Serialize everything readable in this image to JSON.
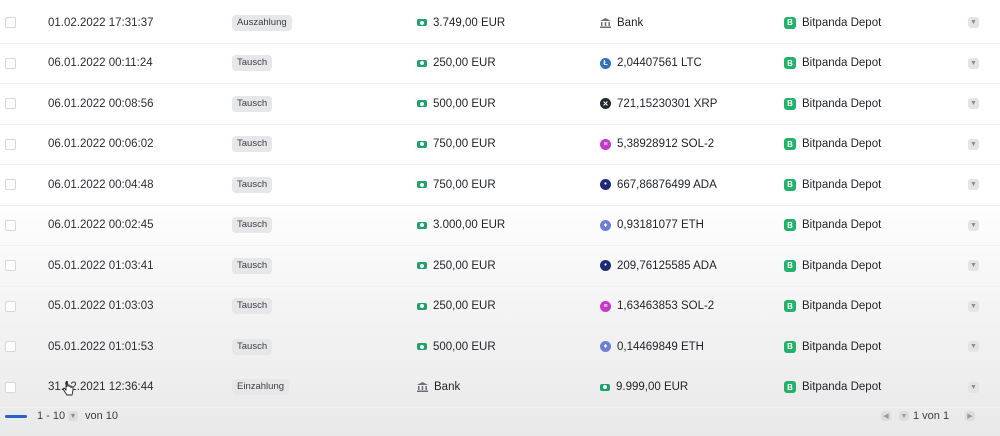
{
  "rows": [
    {
      "date": "01.02.2022 17:31:37",
      "type": "Auszahlung",
      "in_icon": "money-icon",
      "in": "3.749,00 EUR",
      "out_icon": "bank-icon",
      "out": "Bank",
      "wallet": "Bitpanda Depot"
    },
    {
      "date": "06.01.2022 00:11:24",
      "type": "Tausch",
      "in_icon": "money-icon",
      "in": "250,00 EUR",
      "out_icon": "litecoin-icon",
      "out": "2,04407561 LTC",
      "wallet": "Bitpanda Depot"
    },
    {
      "date": "06.01.2022 00:08:56",
      "type": "Tausch",
      "in_icon": "money-icon",
      "in": "500,00 EUR",
      "out_icon": "xrp-icon",
      "out": "721,15230301 XRP",
      "wallet": "Bitpanda Depot"
    },
    {
      "date": "06.01.2022 00:06:02",
      "type": "Tausch",
      "in_icon": "money-icon",
      "in": "750,00 EUR",
      "out_icon": "solana-icon",
      "out": "5,38928912 SOL-2",
      "wallet": "Bitpanda Depot"
    },
    {
      "date": "06.01.2022 00:04:48",
      "type": "Tausch",
      "in_icon": "money-icon",
      "in": "750,00 EUR",
      "out_icon": "cardano-icon",
      "out": "667,86876499 ADA",
      "wallet": "Bitpanda Depot"
    },
    {
      "date": "06.01.2022 00:02:45",
      "type": "Tausch",
      "in_icon": "money-icon",
      "in": "3.000,00 EUR",
      "out_icon": "ethereum-icon",
      "out": "0,93181077 ETH",
      "wallet": "Bitpanda Depot"
    },
    {
      "date": "05.01.2022 01:03:41",
      "type": "Tausch",
      "in_icon": "money-icon",
      "in": "250,00 EUR",
      "out_icon": "cardano-icon",
      "out": "209,76125585 ADA",
      "wallet": "Bitpanda Depot"
    },
    {
      "date": "05.01.2022 01:03:03",
      "type": "Tausch",
      "in_icon": "money-icon",
      "in": "250,00 EUR",
      "out_icon": "solana-icon",
      "out": "1,63463853 SOL-2",
      "wallet": "Bitpanda Depot"
    },
    {
      "date": "05.01.2022 01:01:53",
      "type": "Tausch",
      "in_icon": "money-icon",
      "in": "500,00 EUR",
      "out_icon": "ethereum-icon",
      "out": "0,14469849 ETH",
      "wallet": "Bitpanda Depot"
    },
    {
      "date": "31.12.2021 12:36:44",
      "type": "Einzahlung",
      "in_icon": "bank-icon",
      "in": "Bank",
      "out_icon": "money-icon",
      "out": "9.999,00 EUR",
      "wallet": "Bitpanda Depot"
    }
  ],
  "footer": {
    "range": "1 - 10",
    "of_total": "von 10",
    "page_text": "1 von 1"
  },
  "colors": {
    "accent": "#2563c7",
    "wallet_green": "#22b26a",
    "money_green": "#1fa26a"
  }
}
